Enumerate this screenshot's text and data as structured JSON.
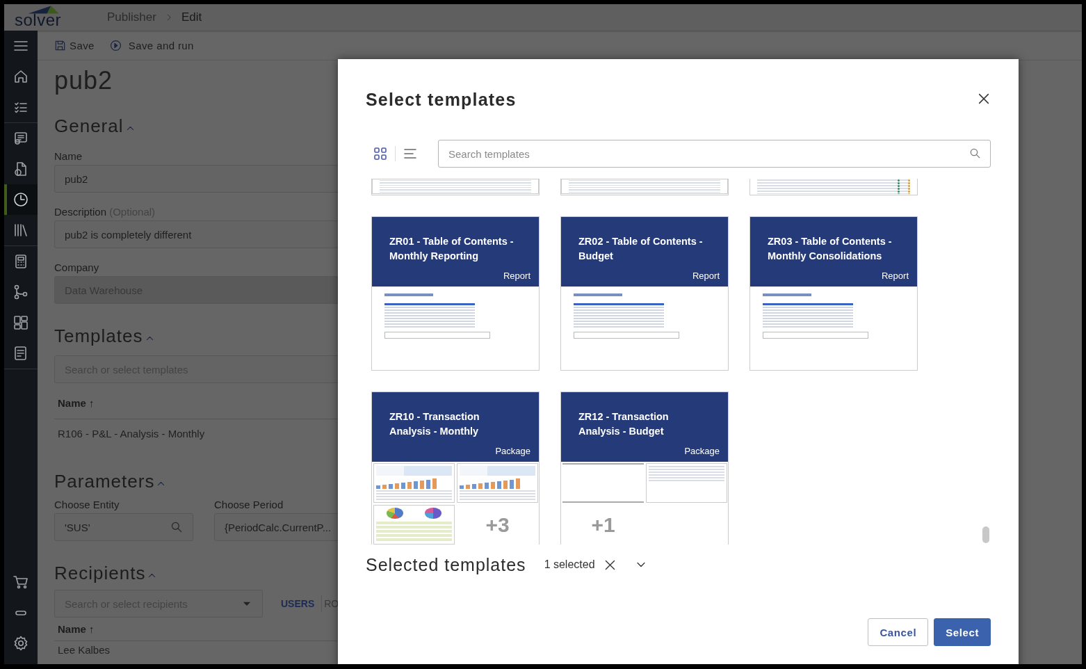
{
  "header": {
    "logo": "solver",
    "breadcrumb": [
      {
        "label": "Publisher",
        "current": false
      },
      {
        "label": "Edit",
        "current": true
      }
    ]
  },
  "sidebar": {
    "groups": [
      [
        {
          "selected": false
        },
        {
          "selected": false
        },
        {
          "selected": false
        }
      ],
      [
        {
          "selected": false
        },
        {
          "selected": false
        },
        {
          "selected": true
        },
        {
          "selected": false
        }
      ],
      [
        {
          "selected": false
        },
        {
          "selected": false
        },
        {
          "selected": false
        },
        {
          "selected": false
        }
      ]
    ],
    "bottom_items": [
      {
        "selected": false
      },
      {
        "selected": false
      },
      {
        "selected": false
      }
    ]
  },
  "toolbar": [
    {
      "label": "Save"
    },
    {
      "label": "Save and run"
    }
  ],
  "page_title": "pub2",
  "general": {
    "heading": "General",
    "name_label": "Name",
    "name_value": "pub2",
    "description_label": "Description",
    "description_hint": "(Optional)",
    "description_value": "pub2 is completely different",
    "company_label": "Company",
    "company_value": "Data Warehouse"
  },
  "templates": {
    "heading": "Templates",
    "placeholder": "Search or select templates",
    "column": "Name ↑",
    "rows": [
      "R106 - P&L - Analysis - Monthly"
    ]
  },
  "parameters": {
    "heading": "Parameters",
    "fields": [
      {
        "label": "Choose Entity",
        "value": "'SUS'"
      },
      {
        "label": "Choose Period",
        "value": "{PeriodCalc.CurrentP..."
      }
    ]
  },
  "recipients": {
    "heading": "Recipients",
    "placeholder": "Search or select recipients",
    "tabs": [
      {
        "label": "USERS",
        "selected": true
      },
      {
        "label": "RO",
        "selected": false
      }
    ],
    "column": "Name ↑",
    "rows": [
      "Lee Kalbes"
    ]
  },
  "modal": {
    "title": "Select templates",
    "view_modes": [
      {
        "selected": true
      },
      {
        "selected": false
      }
    ],
    "search": {
      "placeholder": "Search templates"
    },
    "strips": [
      {
        "kind": "table"
      },
      {
        "kind": "table"
      },
      {
        "kind": "metrics"
      }
    ],
    "cards": [
      {
        "kind": "report",
        "title": "ZR01 - Table of Contents - Monthly Reporting",
        "type": "Report"
      },
      {
        "kind": "report",
        "title": "ZR02 - Table of Contents - Budget",
        "type": "Report"
      },
      {
        "kind": "report",
        "title": "ZR03 - Table of Contents - Monthly Consolidations",
        "type": "Report"
      },
      {
        "kind": "package",
        "title": "ZR10 - Transaction Analysis - Monthly",
        "type": "Package",
        "thumbs": [
          {
            "kind": "chart"
          },
          {
            "kind": "chart"
          },
          {
            "kind": "pie"
          }
        ],
        "more": "+3"
      },
      {
        "kind": "package",
        "title": "ZR12 - Transaction Analysis - Budget",
        "type": "Package",
        "thumbs": [
          {
            "kind": "blank"
          },
          {
            "kind": "table"
          }
        ],
        "more": "+1"
      }
    ],
    "selected_heading": "Selected templates",
    "selected_count": "1 selected",
    "buttons": [
      {
        "kind": "secondary",
        "label": "Cancel"
      },
      {
        "kind": "primary",
        "label": "Select"
      }
    ]
  }
}
